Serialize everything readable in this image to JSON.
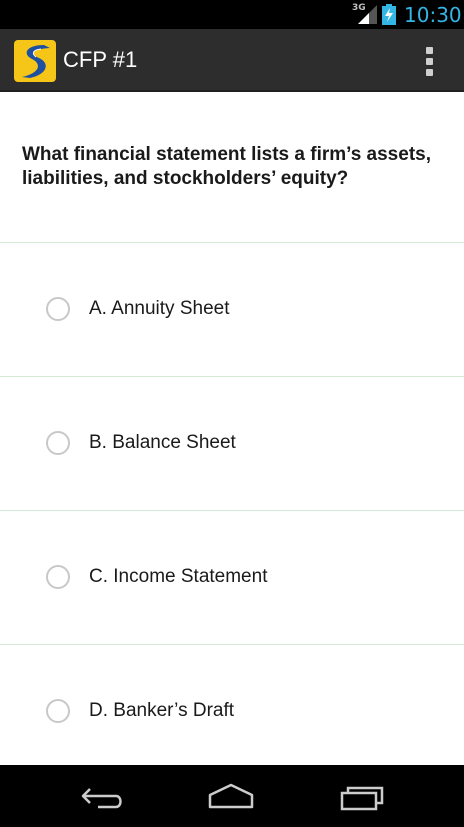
{
  "status_bar": {
    "network_type": "3G",
    "time": "10:30",
    "icons": [
      "signal-icon",
      "battery-charging-icon"
    ],
    "clock_color": "#33b5e5"
  },
  "action_bar": {
    "title": "CFP #1",
    "icons": [
      "app-logo-icon",
      "overflow-menu-icon"
    ]
  },
  "question": {
    "text": "What financial statement lists a firm’s assets, liabilities, and stockholders’ equity?"
  },
  "options": [
    {
      "label": "A. Annuity Sheet",
      "selected": false
    },
    {
      "label": "B. Balance Sheet",
      "selected": false
    },
    {
      "label": "C. Income Statement",
      "selected": false
    },
    {
      "label": "D. Banker’s Draft",
      "selected": false
    }
  ],
  "nav_bar": {
    "icons": [
      "back-icon",
      "home-icon",
      "recent-apps-icon"
    ]
  },
  "colors": {
    "action_bar": "#2d2d2d",
    "divider": "#d4ead4",
    "app_icon_bg": "#f5c518",
    "app_icon_road": "#1f4fa0"
  }
}
